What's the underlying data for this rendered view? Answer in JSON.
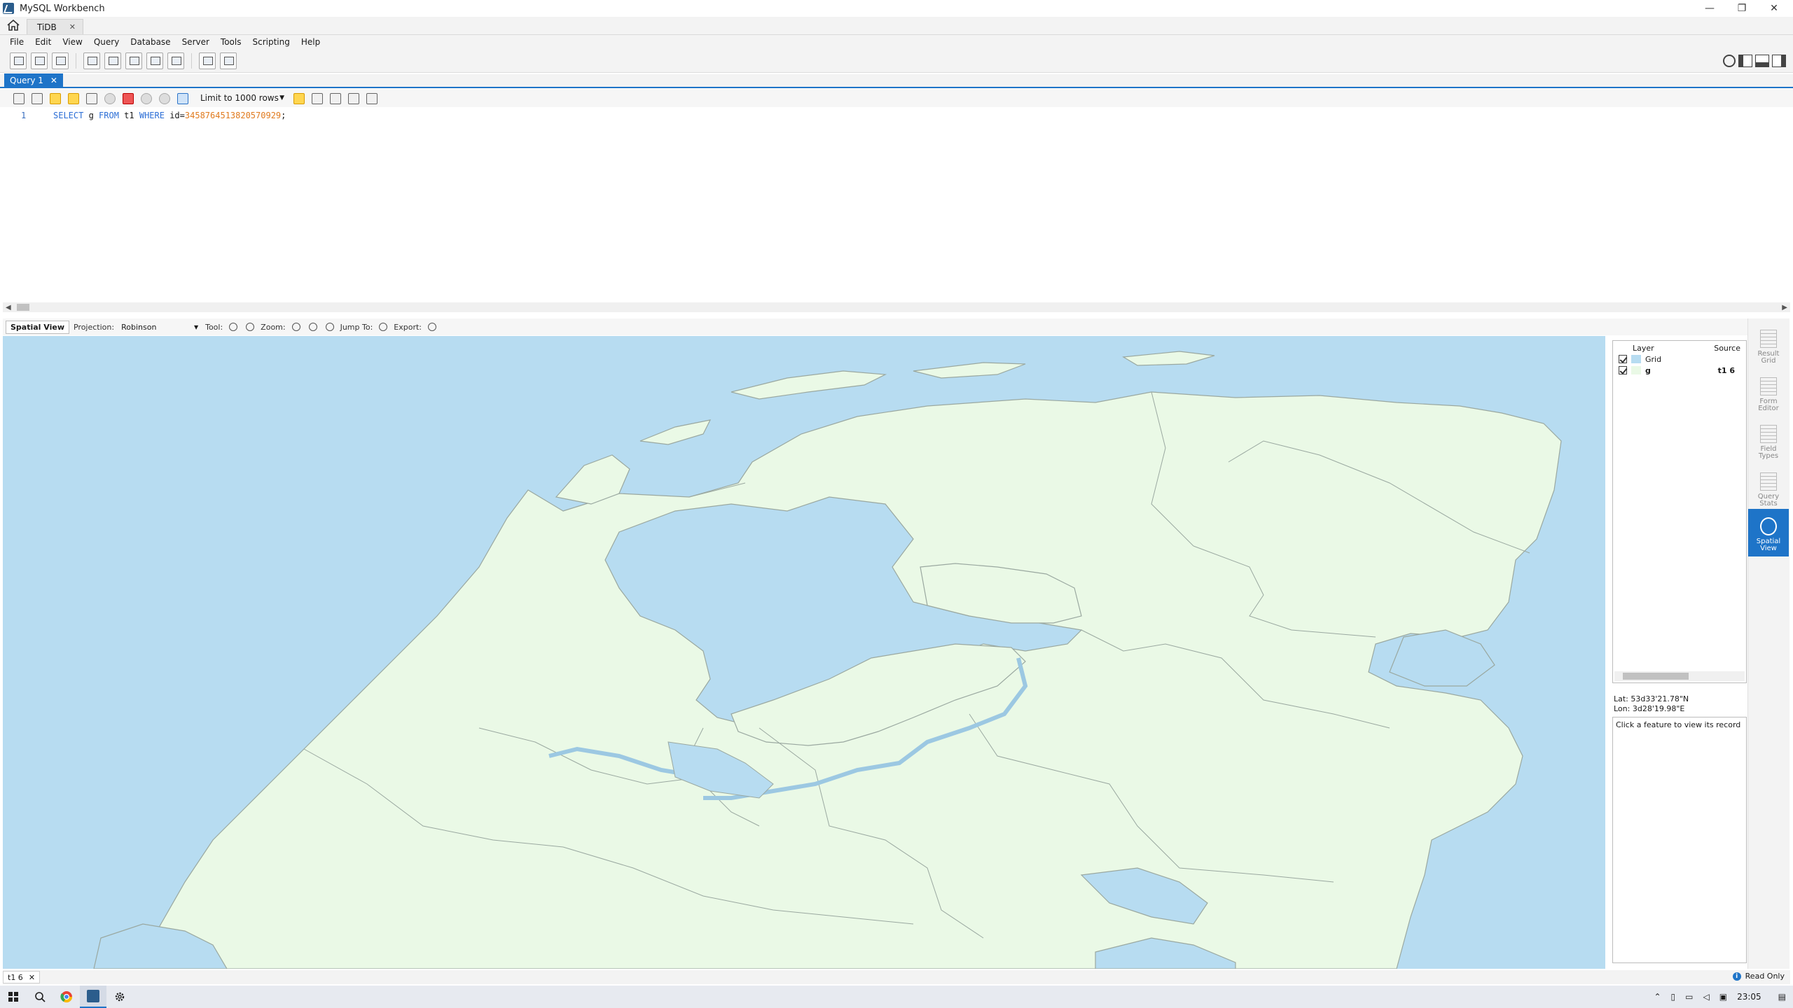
{
  "window": {
    "title": "MySQL Workbench"
  },
  "connection_tab": {
    "label": "TiDB"
  },
  "menu": [
    "File",
    "Edit",
    "View",
    "Query",
    "Database",
    "Server",
    "Tools",
    "Scripting",
    "Help"
  ],
  "query_tab": {
    "label": "Query 1"
  },
  "editor_toolbar": {
    "limit_label": "Limit to 1000 rows"
  },
  "editor": {
    "line_number": "1",
    "sql": {
      "kw1": "SELECT",
      "col": " g ",
      "kw2": "FROM",
      "tbl": " t1 ",
      "kw3": "WHERE",
      "cond": " id=",
      "value": "3458764513820570929",
      "end": ";"
    }
  },
  "spatial_toolbar": {
    "view_label": "Spatial View",
    "projection_label": "Projection:",
    "projection_value": "Robinson",
    "tool_label": "Tool:",
    "zoom_label": "Zoom:",
    "jump_label": "Jump To:",
    "export_label": "Export:"
  },
  "layers": {
    "header_layer": "Layer",
    "header_source": "Source",
    "rows": [
      {
        "name": "Grid",
        "source": "",
        "color": "#b7dcf1"
      },
      {
        "name": "g",
        "source": "t1 6",
        "color": "#eaf9e6"
      }
    ]
  },
  "coords": {
    "lat": "Lat:   53d33'21.78\"N",
    "lon": "Lon:   3d28'19.98\"E"
  },
  "record_hint": "Click a feature to view its record",
  "side_tabs": [
    {
      "label1": "Result",
      "label2": "Grid"
    },
    {
      "label1": "Form",
      "label2": "Editor"
    },
    {
      "label1": "Field",
      "label2": "Types"
    },
    {
      "label1": "Query",
      "label2": "Stats"
    },
    {
      "label1": "Spatial",
      "label2": "View"
    }
  ],
  "results_tab": {
    "label": "t1 6"
  },
  "status": {
    "readonly": "Read Only"
  },
  "taskbar": {
    "clock": "23:05"
  },
  "colors": {
    "water": "#b7dcf1",
    "land": "#eaf9e6",
    "accent": "#1e74c8"
  }
}
